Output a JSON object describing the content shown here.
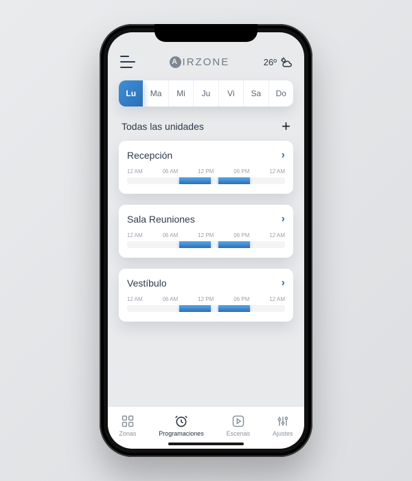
{
  "brand": {
    "mark": "A",
    "text": "IRZONE"
  },
  "weather": {
    "temp": "26º"
  },
  "days": [
    {
      "label": "Lu",
      "active": true
    },
    {
      "label": "Ma",
      "active": false
    },
    {
      "label": "Mi",
      "active": false
    },
    {
      "label": "Ju",
      "active": false
    },
    {
      "label": "Vi",
      "active": false
    },
    {
      "label": "Sa",
      "active": false
    },
    {
      "label": "Do",
      "active": false
    }
  ],
  "section": {
    "title": "Todas las unidades"
  },
  "time_labels": [
    "12 AM",
    "06 AM",
    "12 PM",
    "06 PM",
    "12 AM"
  ],
  "units": [
    {
      "name": "Recepción",
      "segments": [
        {
          "start": 33,
          "end": 53
        },
        {
          "start": 58,
          "end": 78
        }
      ]
    },
    {
      "name": "Sala Reuniones",
      "segments": [
        {
          "start": 33,
          "end": 53
        },
        {
          "start": 58,
          "end": 78
        }
      ]
    },
    {
      "name": "Vestíbulo",
      "segments": [
        {
          "start": 33,
          "end": 53
        },
        {
          "start": 58,
          "end": 78
        }
      ]
    }
  ],
  "tabs": [
    {
      "label": "Zonas"
    },
    {
      "label": "Programaciones"
    },
    {
      "label": "Escenas"
    },
    {
      "label": "Ajustes"
    }
  ]
}
